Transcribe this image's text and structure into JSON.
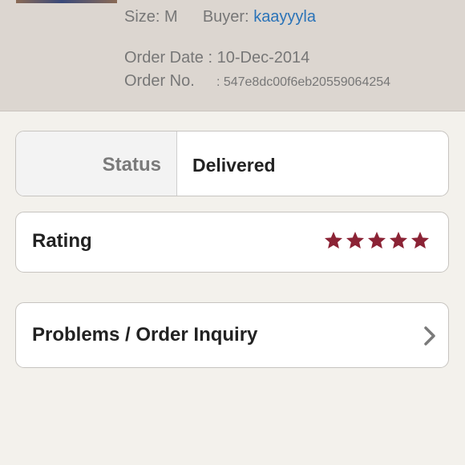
{
  "order": {
    "size_text": "Size: M",
    "buyer_label": "Buyer:",
    "buyer_name": "kaayyyla",
    "order_date_label": "Order Date",
    "order_date_value": ": 10-Dec-2014",
    "order_no_label": "Order No.",
    "order_no_value": ": 547e8dc00f6eb20559064254"
  },
  "status": {
    "label": "Status",
    "value": "Delivered"
  },
  "rating": {
    "label": "Rating",
    "stars": 5,
    "max_stars": 5,
    "star_color": "#8b2335"
  },
  "problems": {
    "label": "Problems / Order Inquiry",
    "icon": "chevron-right-icon"
  },
  "colors": {
    "link": "#2a73b8",
    "header_bg": "#dcd6d0",
    "page_bg": "#f3f1ec"
  }
}
